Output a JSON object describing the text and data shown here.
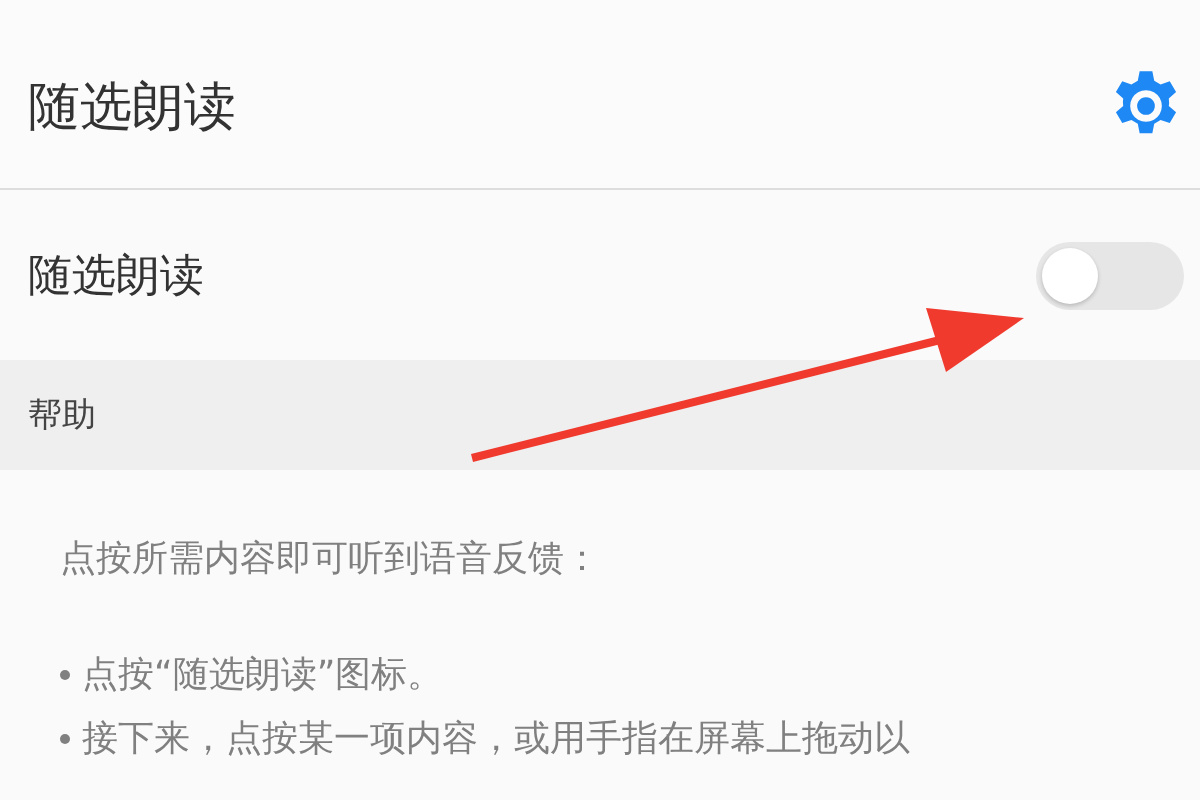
{
  "header": {
    "title": "随选朗读"
  },
  "settings": [
    {
      "label": "随选朗读",
      "on": false
    }
  ],
  "help": {
    "heading": "帮助",
    "intro": "点按所需内容即可听到语音反馈：",
    "steps": [
      "点按“随选朗读”图标。",
      "接下来，点按某一项内容，或用手指在屏幕上拖动以"
    ]
  },
  "annotation": {
    "kind": "arrow"
  }
}
